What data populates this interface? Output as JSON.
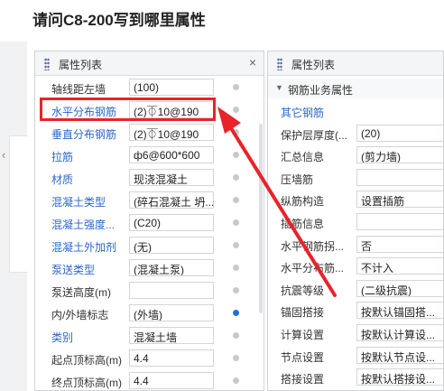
{
  "question_title": "请问C8-200写到哪里属性",
  "left_panel": {
    "title": "属性列表",
    "close_glyph": "×",
    "rows": [
      {
        "label": "轴线距左墙",
        "value": "(100)",
        "blue": false,
        "dot": "grey"
      },
      {
        "label": "水平分布钢筋",
        "value": "(2)⏁10@190",
        "blue": true,
        "dot": "grey"
      },
      {
        "label": "垂直分布钢筋",
        "value": "(2)⏁10@190",
        "blue": true,
        "dot": "grey"
      },
      {
        "label": "拉筋",
        "value": "ф6@600*600",
        "blue": true,
        "dot": "grey"
      },
      {
        "label": "材质",
        "value": "现浇混凝土",
        "blue": true,
        "dot": "grey"
      },
      {
        "label": "混凝土类型",
        "value": "(碎石混凝土 坍...",
        "blue": true,
        "dot": "grey"
      },
      {
        "label": "混凝土强度...",
        "value": "(C20)",
        "blue": true,
        "dot": "grey"
      },
      {
        "label": "混凝土外加剂",
        "value": "(无)",
        "blue": true,
        "dot": "grey"
      },
      {
        "label": "泵送类型",
        "value": "(混凝土泵)",
        "blue": true,
        "dot": "grey"
      },
      {
        "label": "泵送高度(m)",
        "value": "",
        "blue": false,
        "dot": "grey"
      },
      {
        "label": "内/外墙标志",
        "value": "(外墙)",
        "blue": false,
        "dot": "blue"
      },
      {
        "label": "类别",
        "value": "混凝土墙",
        "blue": true,
        "dot": "grey"
      },
      {
        "label": "起点顶标高(m)",
        "value": "4.4",
        "blue": false,
        "dot": "grey"
      },
      {
        "label": "终点顶标高(m)",
        "value": "4.4",
        "blue": false,
        "dot": "grey"
      }
    ]
  },
  "right_panel": {
    "title": "属性列表",
    "group_label": "钢筋业务属性",
    "rows": [
      {
        "label": "其它钢筋",
        "value": "",
        "blue": true,
        "has_box": false
      },
      {
        "label": "保护层厚度(...",
        "value": "(20)",
        "blue": false,
        "has_box": true
      },
      {
        "label": "汇总信息",
        "value": "(剪力墙)",
        "blue": false,
        "has_box": true
      },
      {
        "label": "压墙筋",
        "value": "",
        "blue": false,
        "has_box": true
      },
      {
        "label": "纵筋构造",
        "value": "设置插筋",
        "blue": false,
        "has_box": true
      },
      {
        "label": "插筋信息",
        "value": "",
        "blue": false,
        "has_box": true
      },
      {
        "label": "水平钢筋拐...",
        "value": "否",
        "blue": false,
        "has_box": true
      },
      {
        "label": "水平分布筋...",
        "value": "不计入",
        "blue": false,
        "has_box": true
      },
      {
        "label": "抗震等级",
        "value": "(二级抗震)",
        "blue": false,
        "has_box": true
      },
      {
        "label": "锚固搭接",
        "value": "按默认锚固搭...",
        "blue": false,
        "has_box": true
      },
      {
        "label": "计算设置",
        "value": "按默认计算设...",
        "blue": false,
        "has_box": true
      },
      {
        "label": "节点设置",
        "value": "按默认节点设...",
        "blue": false,
        "has_box": true
      },
      {
        "label": "搭接设置",
        "value": "按默认搭接设...",
        "blue": false,
        "has_box": true
      }
    ]
  },
  "annotation_color": "#e8232a"
}
